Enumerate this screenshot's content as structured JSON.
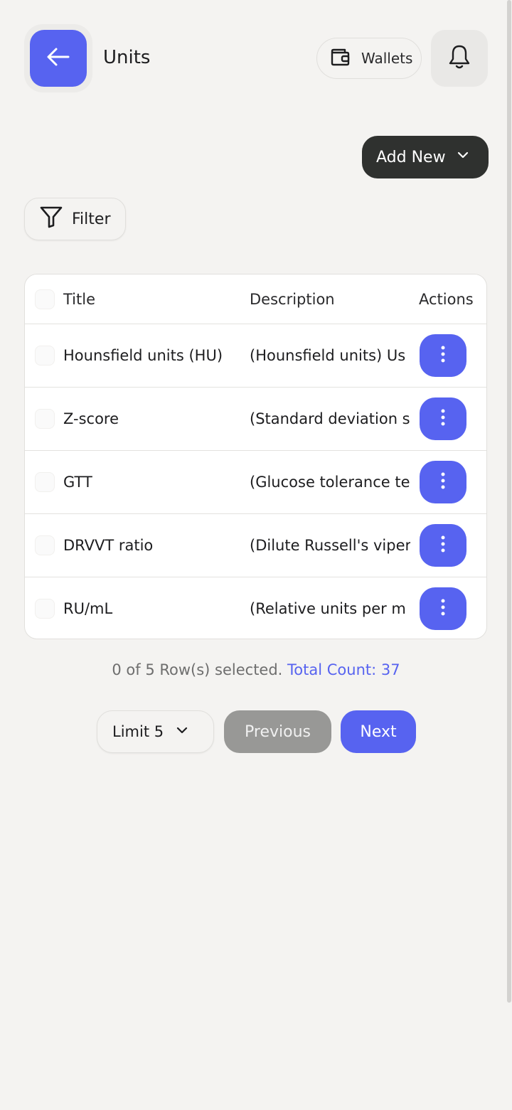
{
  "header": {
    "title": "Units",
    "back_icon": "arrow-left-icon",
    "wallets_label": "Wallets",
    "wallet_icon": "wallet-icon",
    "bell_icon": "bell-icon"
  },
  "toolbar": {
    "add_new_label": "Add New",
    "filter_label": "Filter"
  },
  "table": {
    "columns": [
      "Title",
      "Description",
      "Actions"
    ],
    "rows": [
      {
        "title": "Hounsfield units (HU)",
        "description": "(Hounsfield units) Us"
      },
      {
        "title": "Z-score",
        "description": "(Standard deviation s"
      },
      {
        "title": "GTT",
        "description": "(Glucose tolerance te"
      },
      {
        "title": "DRVVT ratio",
        "description": "(Dilute Russell's viper"
      },
      {
        "title": "RU/mL",
        "description": "(Relative units per m"
      }
    ]
  },
  "footer": {
    "selected_text": "0 of 5 Row(s) selected.",
    "total_text": "Total Count: 37",
    "limit_label": "Limit 5",
    "previous_label": "Previous",
    "next_label": "Next"
  },
  "colors": {
    "accent": "#5763f0",
    "dark_button": "#2f312f",
    "disabled_button": "#989896",
    "background": "#f4f3f1"
  }
}
